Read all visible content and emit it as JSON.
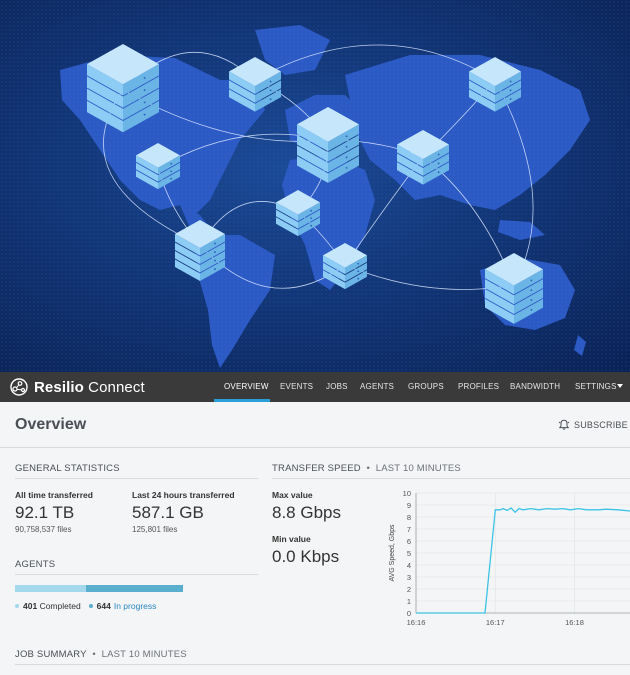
{
  "brand": {
    "name_bold": "Resilio",
    "name_rest": " Connect"
  },
  "nav": {
    "items": [
      {
        "label": "OVERVIEW",
        "active": true
      },
      {
        "label": "EVENTS"
      },
      {
        "label": "JOBS"
      },
      {
        "label": "AGENTS"
      },
      {
        "label": "GROUPS"
      },
      {
        "label": "PROFILES"
      },
      {
        "label": "BANDWIDTH"
      },
      {
        "label": "SETTINGS"
      }
    ]
  },
  "page": {
    "title": "Overview",
    "subscribe": "SUBSCRIBE"
  },
  "general": {
    "title": "GENERAL STATISTICS",
    "all_time_label": "All time transferred",
    "all_time_value": "92.1 TB",
    "all_time_files": "90,758,537 files",
    "last24_label": "Last 24 hours transferred",
    "last24_value": "587.1 GB",
    "last24_files": "125,801 files"
  },
  "agents": {
    "title": "AGENTS",
    "completed_count": "401",
    "completed_label": "Completed",
    "inprogress_count": "644",
    "inprogress_label": "In progress",
    "completed_fraction": 0.4249,
    "colors": {
      "completed": "#a4d8ec",
      "in_progress": "#5aafce"
    }
  },
  "transfer": {
    "title": "TRANSFER SPEED",
    "period": "LAST 10 MINUTES",
    "max_label": "Max value",
    "max_value": "8.8 Gbps",
    "min_label": "Min value",
    "min_value": "0.0 Kbps"
  },
  "job_summary": {
    "title": "JOB SUMMARY",
    "period": "LAST 10 MINUTES"
  },
  "chart_data": {
    "type": "line",
    "ylabel": "AVG Speed, Gbps",
    "xlabel": "",
    "ylim": [
      0,
      10
    ],
    "yticks": [
      0,
      1,
      2,
      3,
      4,
      5,
      6,
      7,
      8,
      9,
      10
    ],
    "xticks": [
      "16:16",
      "16:17",
      "16:18"
    ],
    "grid": true,
    "line_color": "#3cc3e6",
    "series": [
      {
        "values": [
          [
            0.0,
            0.0
          ],
          [
            0.25,
            0.0
          ],
          [
            0.5,
            0.0
          ],
          [
            0.75,
            0.0
          ],
          [
            0.87,
            0.0
          ],
          [
            1.0,
            8.6
          ],
          [
            1.06,
            8.6
          ],
          [
            1.1,
            8.7
          ],
          [
            1.15,
            8.55
          ],
          [
            1.2,
            8.75
          ],
          [
            1.25,
            8.4
          ],
          [
            1.3,
            8.7
          ],
          [
            1.35,
            8.6
          ],
          [
            1.45,
            8.7
          ],
          [
            1.55,
            8.6
          ],
          [
            1.65,
            8.7
          ],
          [
            1.75,
            8.65
          ],
          [
            1.85,
            8.7
          ],
          [
            1.95,
            8.6
          ],
          [
            2.05,
            8.7
          ],
          [
            2.15,
            8.6
          ],
          [
            2.3,
            8.6
          ],
          [
            2.4,
            8.65
          ],
          [
            2.55,
            8.6
          ],
          [
            2.7,
            8.5
          ]
        ]
      }
    ]
  },
  "hero": {
    "colors": {
      "sky_top": "#0a2255",
      "land": "#2c5ac5",
      "server": "#8dcdf5"
    }
  }
}
